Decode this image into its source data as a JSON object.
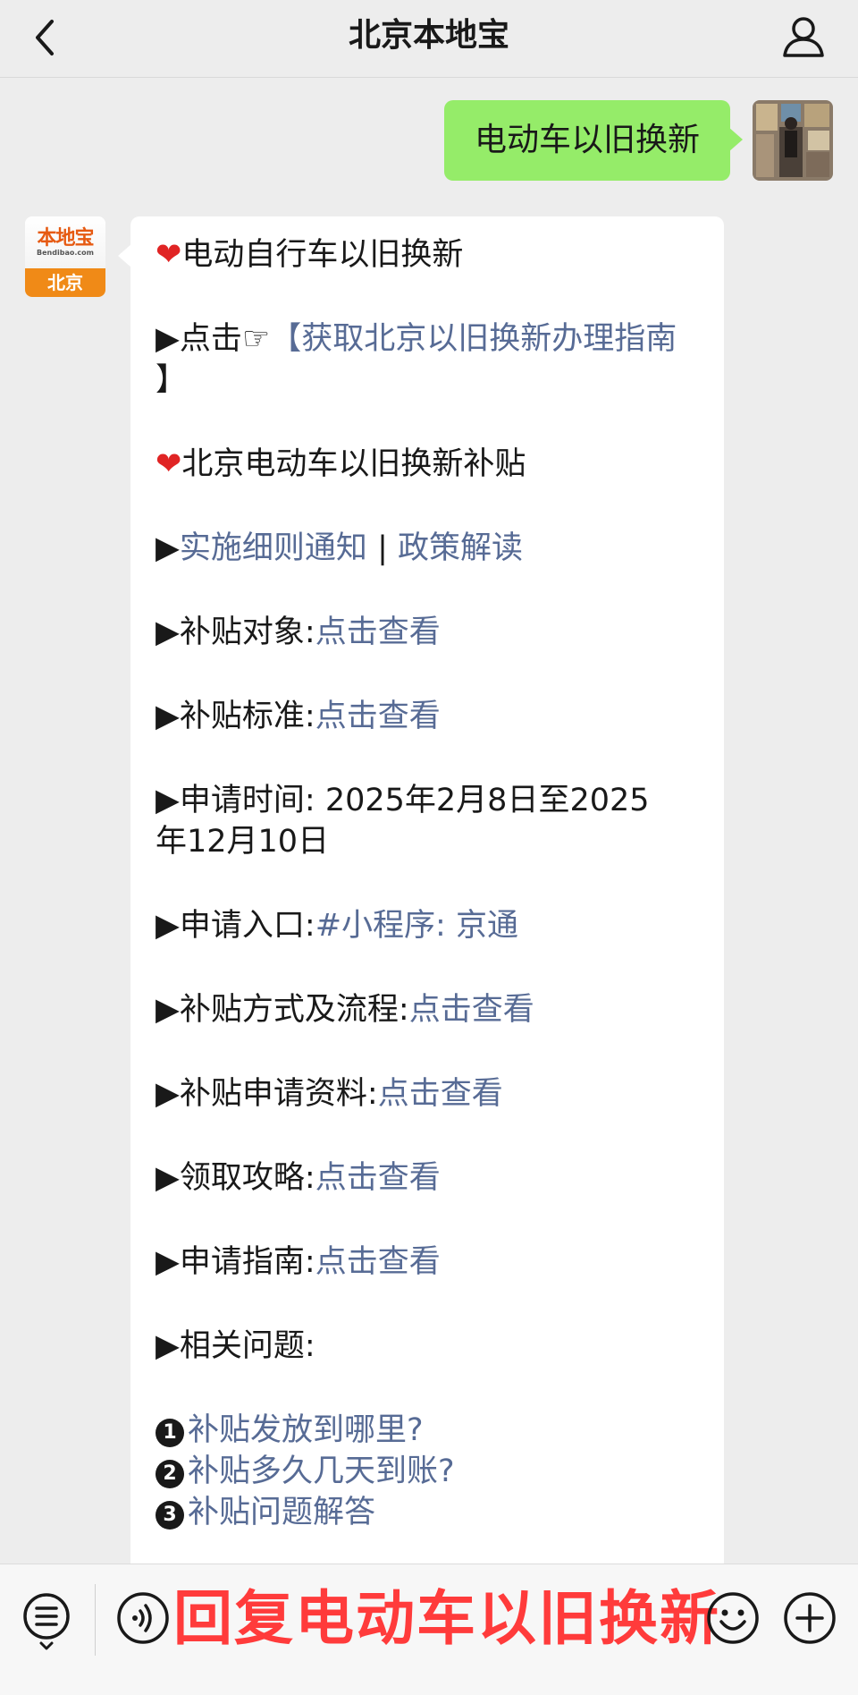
{
  "nav": {
    "title": "北京本地宝",
    "back_icon": "back-chevron-icon",
    "profile_icon": "person-icon"
  },
  "sent_message": {
    "text": "电动车以旧换新"
  },
  "bot": {
    "avatar_logo_text": "本地宝",
    "avatar_logo_url": "Bendibao.com",
    "avatar_city": "北京"
  },
  "message": {
    "heading1": "电动自行车以旧换新",
    "guide_prefix": "▶点击☞",
    "guide_link_line1": "【获取北京以旧换新办理指南",
    "guide_link_line2": "】",
    "heading2": "北京电动车以旧换新补贴",
    "policy_prefix": "▶",
    "policy_link1": "实施细则通知",
    "policy_sep": " | ",
    "policy_link2": "政策解读",
    "items": [
      {
        "label": "▶补贴对象:",
        "link": "点击查看"
      },
      {
        "label": "▶补贴标准:",
        "link": "点击查看"
      }
    ],
    "apply_time_line1": "▶申请时间: 2025年2月8日至2025",
    "apply_time_line2": "年12月10日",
    "entry_label": "▶申请入口:",
    "entry_link": "#小程序: 京通",
    "items2": [
      {
        "label": "▶补贴方式及流程:",
        "link": "点击查看"
      },
      {
        "label": "▶补贴申请资料:",
        "link": "点击查看"
      },
      {
        "label": "▶领取攻略:",
        "link": "点击查看"
      },
      {
        "label": "▶申请指南:",
        "link": "点击查看"
      }
    ],
    "related_label": "▶相关问题:",
    "questions": [
      {
        "num": "1",
        "text": "补贴发放到哪里?"
      },
      {
        "num": "2",
        "text": "补贴多久几天到账?"
      },
      {
        "num": "3",
        "text": "补贴问题解答"
      }
    ]
  },
  "bottom": {
    "reply_text": "回复电动车以旧换新",
    "menu_icon": "menu-list-icon",
    "voice_icon": "voice-icon",
    "emoji_icon": "emoji-icon",
    "plus_icon": "plus-icon"
  },
  "colors": {
    "link": "#576b95",
    "sent_bubble": "#95ec69",
    "reply_text": "#ff3b3b",
    "background": "#ededed"
  }
}
